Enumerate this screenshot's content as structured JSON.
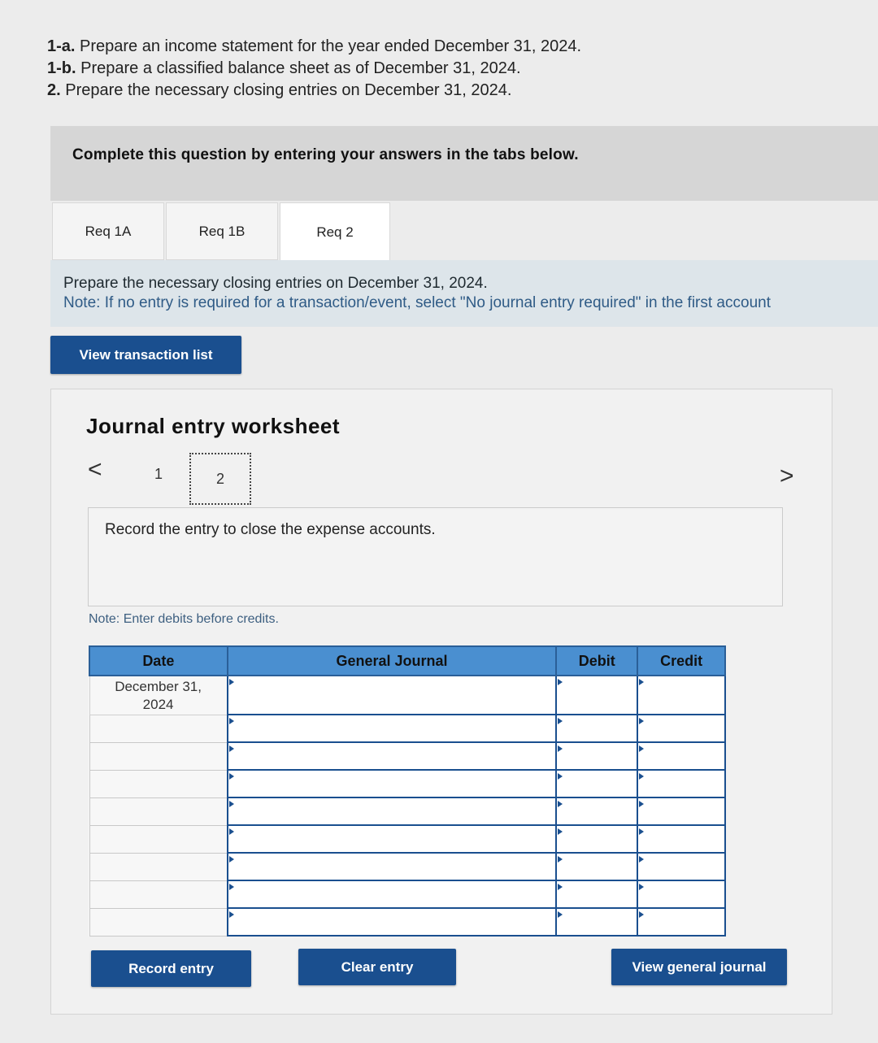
{
  "instructions": [
    {
      "label": "1-a.",
      "text": "Prepare an income statement for the year ended December 31, 2024."
    },
    {
      "label": "1-b.",
      "text": "Prepare a classified balance sheet as of December 31, 2024."
    },
    {
      "label": "2.",
      "text": "Prepare the necessary closing entries on December 31, 2024."
    }
  ],
  "banner": "Complete this question by entering your answers in the tabs below.",
  "tabs": [
    "Req 1A",
    "Req 1B",
    "Req 2"
  ],
  "active_tab": "Req 2",
  "req_panel": {
    "prompt": "Prepare the necessary closing entries on December 31, 2024.",
    "note": "Note: If no entry is required for a transaction/event, select \"No journal entry required\" in the first account"
  },
  "buttons": {
    "view_transaction_list": "View transaction list",
    "record_entry": "Record entry",
    "clear_entry": "Clear entry",
    "view_general_journal": "View general journal"
  },
  "worksheet": {
    "title": "Journal entry worksheet",
    "prev_icon": "<",
    "next_icon": ">",
    "pages": [
      "1",
      "2"
    ],
    "current_page": "2",
    "instruction": "Record the entry to close the expense accounts.",
    "note": "Note: Enter debits before credits."
  },
  "table": {
    "headers": {
      "date": "Date",
      "journal": "General Journal",
      "debit": "Debit",
      "credit": "Credit"
    },
    "first_date_line1": "December 31,",
    "first_date_line2": "2024"
  },
  "colors": {
    "accent": "#1a4f8f",
    "header": "#4a8fd0"
  }
}
